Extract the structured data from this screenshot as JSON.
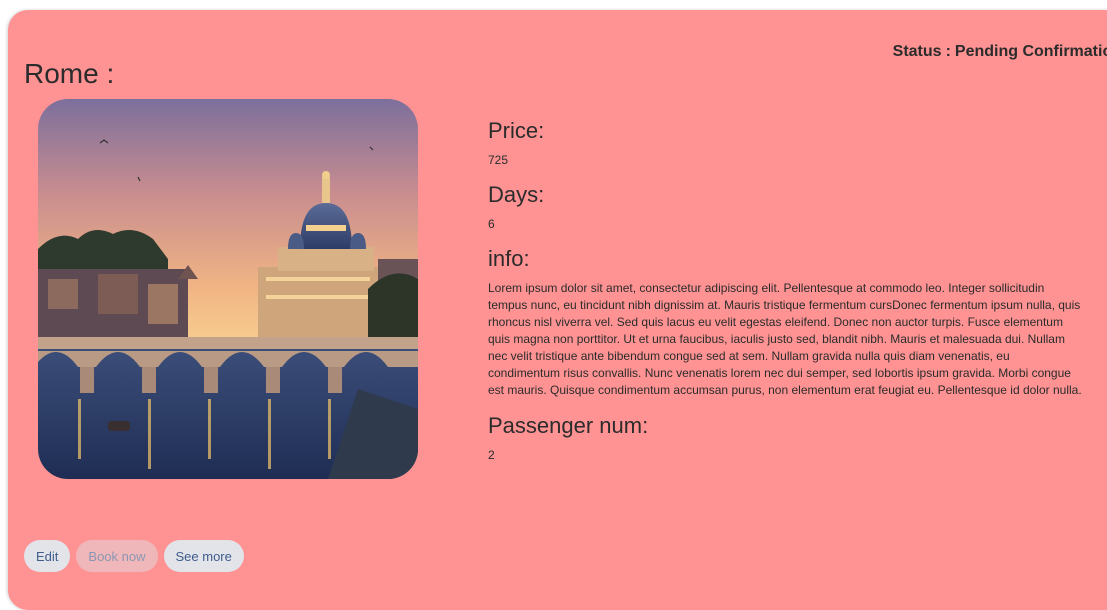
{
  "status": {
    "label": "Status",
    "separator": ":",
    "value": "Pending Confirmation"
  },
  "trip": {
    "city_title": "Rome :",
    "image_icon": "rome-sunset-photo",
    "price_label": "Price:",
    "price_value": "725",
    "days_label": "Days:",
    "days_value": "6",
    "info_label": "info:",
    "info_text": "Lorem ipsum dolor sit amet, consectetur adipiscing elit. Pellentesque at commodo leo. Integer sollicitudin tempus nunc, eu tincidunt nibh dignissim at. Mauris tristique fermentum cursDonec fermentum ipsum nulla, quis rhoncus nisl viverra vel. Sed quis lacus eu velit egestas eleifend. Donec non auctor turpis. Fusce elementum quis magna non porttitor. Ut et urna faucibus, iaculis justo sed, blandit nibh. Mauris et malesuada dui. Nullam nec velit tristique ante bibendum congue sed at sem. Nullam gravida nulla quis diam venenatis, eu condimentum risus convallis. Nunc venenatis lorem nec dui semper, sed lobortis ipsum gravida. Morbi congue est mauris. Quisque condimentum accumsan purus, non elementum erat feugiat eu. Pellentesque id dolor nulla.",
    "passenger_label": "Passenger num:",
    "passenger_value": "2"
  },
  "buttons": {
    "edit": "Edit",
    "book_now": "Book now",
    "see_more": "See more"
  },
  "colors": {
    "card_background": "#ff9393",
    "button_background": "#e2e4ea",
    "button_text": "#3f5c8a",
    "disabled_button_background": "#f0b7ba"
  }
}
